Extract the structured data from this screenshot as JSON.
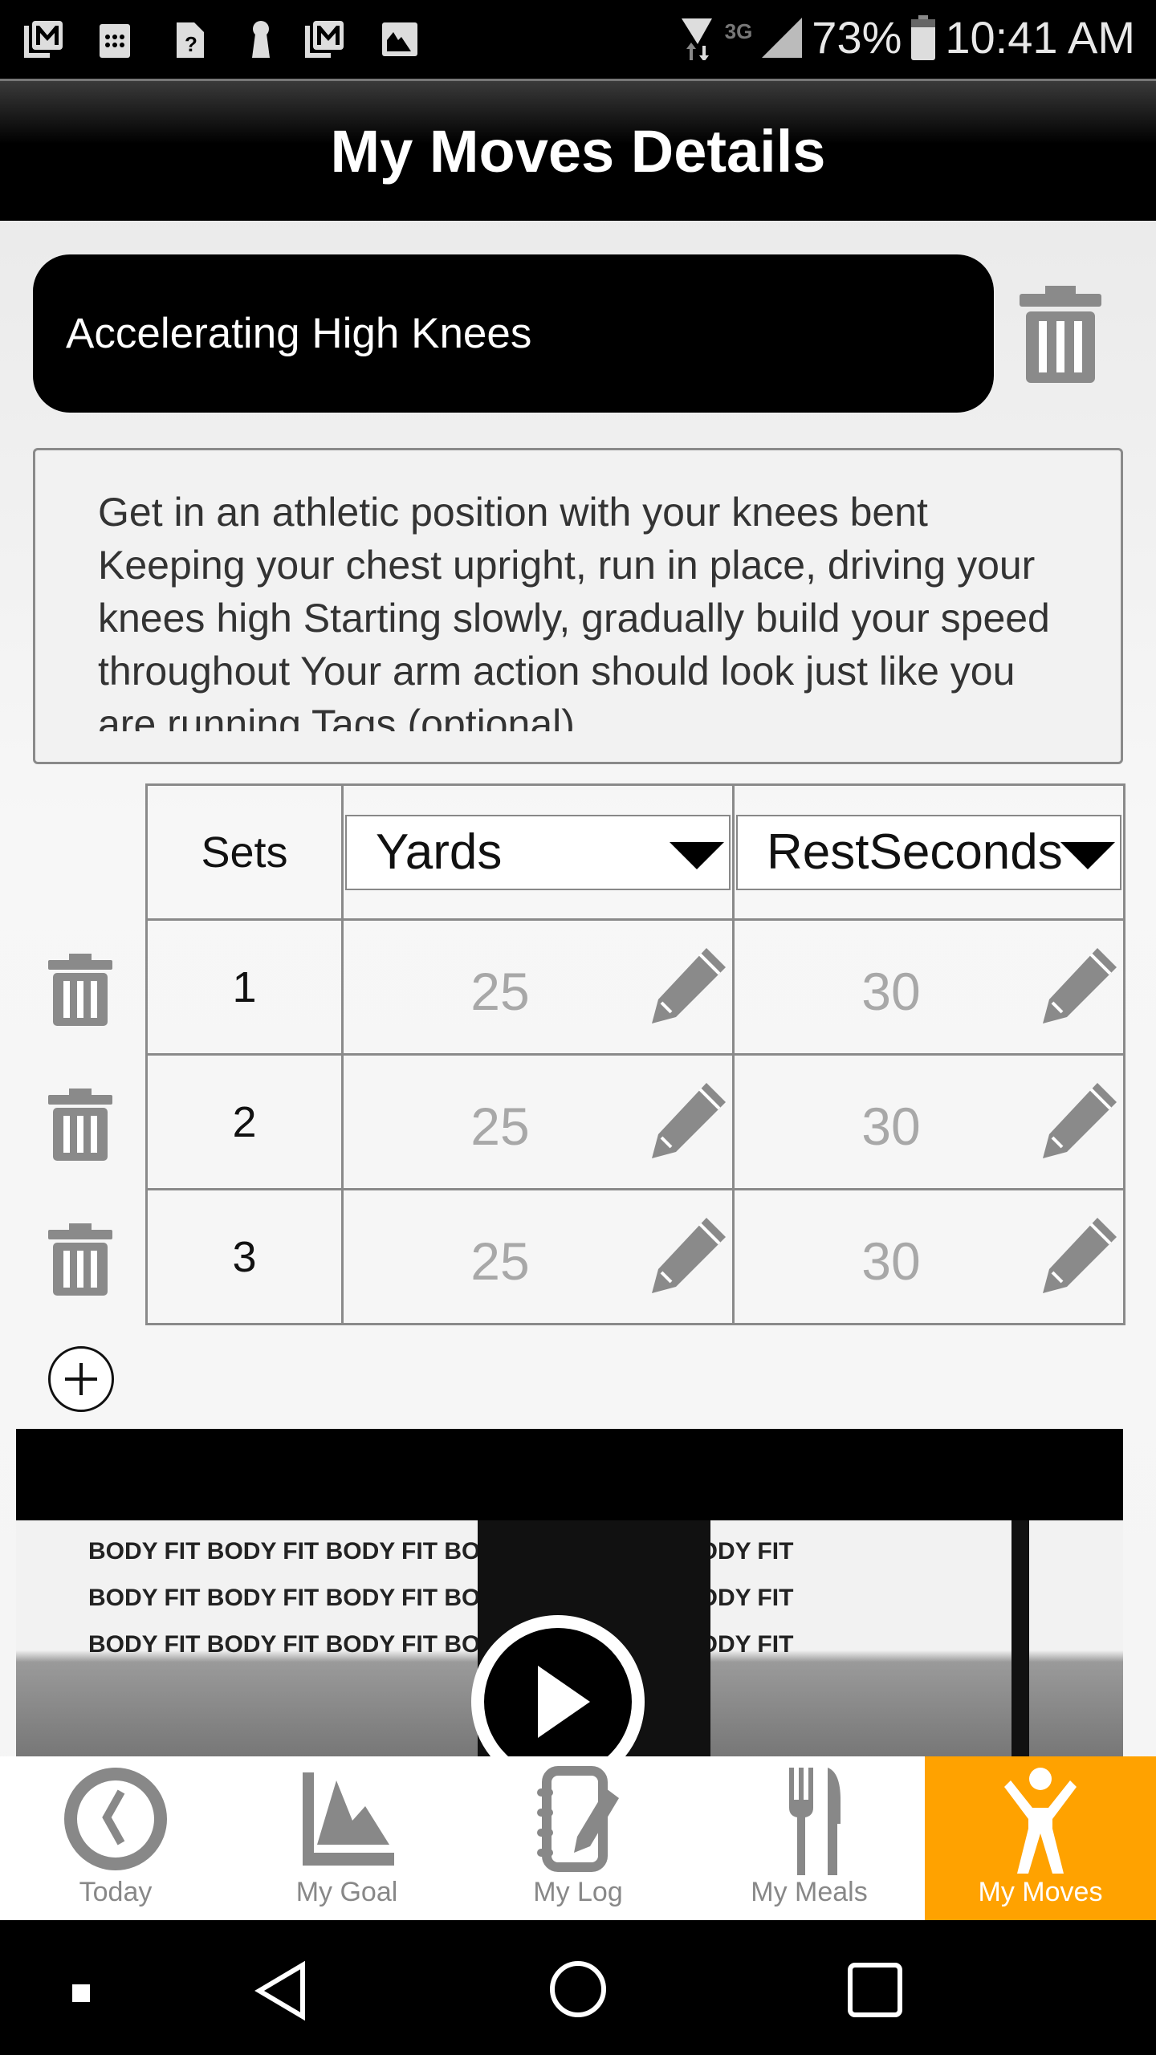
{
  "status_bar": {
    "icons": [
      "gmail-icon",
      "calendar-icon",
      "sim-unknown-icon",
      "keyhole-icon",
      "gmail-icon",
      "image-icon"
    ],
    "network": "3G",
    "battery": "73%",
    "time": "10:41 AM"
  },
  "header": {
    "title": "My Moves Details"
  },
  "exercise": {
    "name": "Accelerating High Knees",
    "description": "Get in an athletic position with your knees bent Keeping your chest upright, run in place, driving your knees high Starting slowly, gradually build your speed throughout Your arm action should look just like you are running Tags (optional)"
  },
  "table": {
    "headers": {
      "sets": "Sets",
      "col2": "Yards",
      "col3": "RestSeconds"
    },
    "rows": [
      {
        "set": "1",
        "yards": "25",
        "rest": "30"
      },
      {
        "set": "2",
        "yards": "25",
        "rest": "30"
      },
      {
        "set": "3",
        "yards": "25",
        "rest": "30"
      }
    ]
  },
  "video": {
    "banner_text": "BODY FIT BODY FIT BODY FIT BODY FIT BODY FIT BODY FIT"
  },
  "bottom_nav": {
    "active_color": "#ffa200",
    "items": [
      {
        "label": "Today",
        "icon": "clock-icon"
      },
      {
        "label": "My Goal",
        "icon": "chart-icon"
      },
      {
        "label": "My Log",
        "icon": "notebook-icon"
      },
      {
        "label": "My Meals",
        "icon": "fork-knife-icon"
      },
      {
        "label": "My Moves",
        "icon": "person-icon",
        "active": true
      }
    ]
  }
}
